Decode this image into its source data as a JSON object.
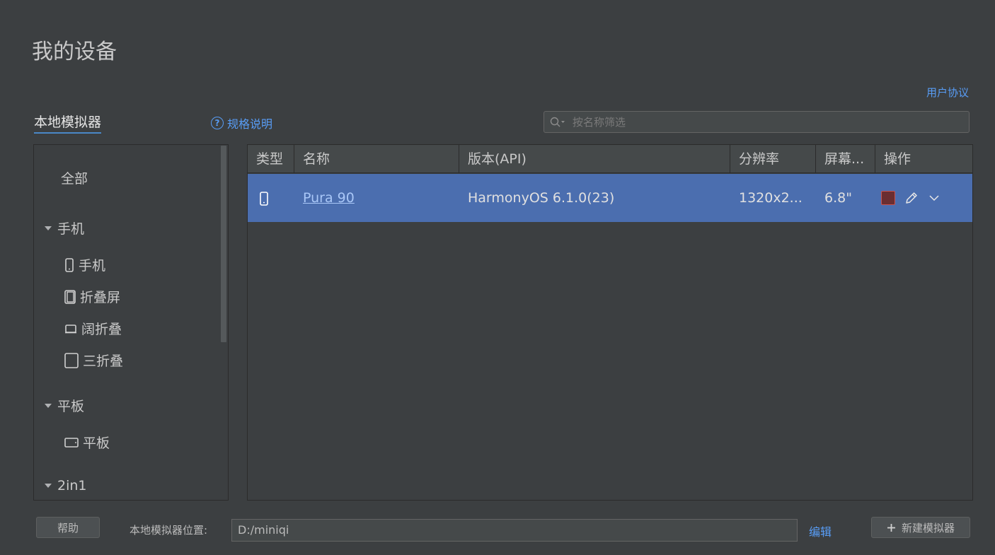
{
  "page": {
    "title": "我的设备",
    "user_agreement": "用户协议"
  },
  "tabs": {
    "local_emulator": "本地模拟器",
    "spec_link": "规格说明"
  },
  "search": {
    "placeholder": "按名称筛选",
    "value": ""
  },
  "sidebar": {
    "all": "全部",
    "groups": [
      {
        "label": "手机",
        "items": [
          "手机",
          "折叠屏",
          "阔折叠",
          "三折叠"
        ]
      },
      {
        "label": "平板",
        "items": [
          "平板"
        ]
      },
      {
        "label": "2in1",
        "items": []
      }
    ]
  },
  "table": {
    "headers": [
      "类型",
      "名称",
      "版本(API)",
      "分辨率",
      "屏幕...",
      "操作"
    ],
    "rows": [
      {
        "type_icon": "phone-icon",
        "name": "Pura 90",
        "version": "HarmonyOS 6.1.0(23)",
        "resolution": "1320x2...",
        "screen": "6.8\""
      }
    ]
  },
  "footer": {
    "help_button": "帮助",
    "location_label": "本地模拟器位置:",
    "location_value": "D:/miniqi",
    "edit_link": "编辑",
    "new_emulator_button": "新建模拟器"
  },
  "colors": {
    "accent_link": "#589df6",
    "selected_row": "#4b6eaf",
    "stop_button": "#c75450",
    "background": "#3c3f41"
  }
}
